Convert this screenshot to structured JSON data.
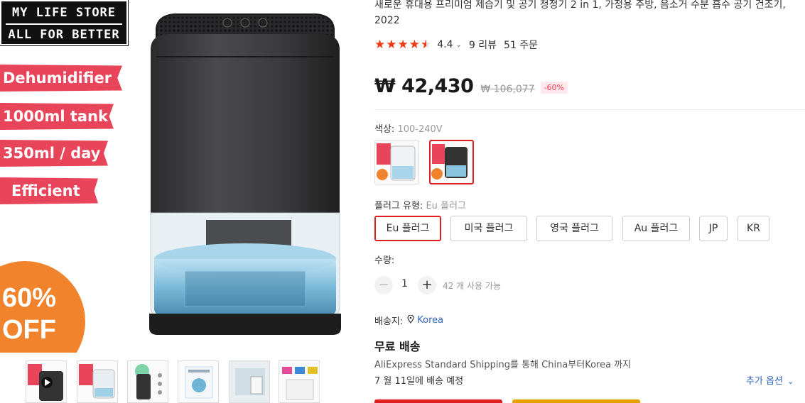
{
  "image_overlay": {
    "brand_line1": "MY LIFE STORE",
    "brand_line2": "ALL FOR BETTER",
    "tags": [
      "Dehumidifier",
      "1000ml tank",
      "350ml / day",
      "Efficient"
    ],
    "badge_line1": "60%",
    "badge_line2": "OFF"
  },
  "product": {
    "title": "새로운 휴대용 프리미엄 제습기 및 공기 청정기 2 in 1, 가정용 주방, 음소거 수분 흡수 공기 건조기, 2022",
    "rating": "4.4",
    "rating_value": 4.4,
    "reviews": "9 리뷰",
    "orders": "51 주문",
    "price": "₩ 42,430",
    "original_price": "₩ 106,077",
    "discount": "-60%"
  },
  "color": {
    "label": "색상:",
    "value": "100-240V"
  },
  "plug": {
    "label": "플러그 유형:",
    "value": "Eu 플러그",
    "options": [
      "Eu 플러그",
      "미국 플러그",
      "영국 플러그",
      "Au 플러그",
      "JP",
      "KR"
    ]
  },
  "quantity": {
    "label": "수량:",
    "minus": "−",
    "value": "1",
    "plus": "+",
    "available": "42 개 사용 가능"
  },
  "shipping": {
    "ship_to_label": "배송지:",
    "country": "Korea",
    "free_shipping": "무료 배송",
    "method": "AliExpress Standard Shipping를 통해 China부터Korea 까지",
    "delivery": "7 월 11일에 배송 예정",
    "more_options": "추가 옵션"
  },
  "colors": {
    "accent": "#e02020",
    "star": "#f03a17",
    "link": "#2e63b8",
    "tag": "#e8445a",
    "badge": "#f0832b"
  }
}
